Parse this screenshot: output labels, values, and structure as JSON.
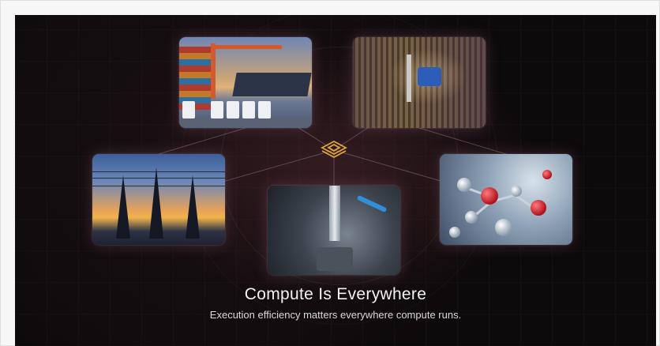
{
  "hero": {
    "title": "Compute Is Everywhere",
    "subtitle": "Execution efficiency matters everywhere compute runs."
  },
  "images": [
    {
      "name": "shipping-port-image"
    },
    {
      "name": "agriculture-drone-image"
    },
    {
      "name": "power-lines-image"
    },
    {
      "name": "cnc-machining-image"
    },
    {
      "name": "molecules-image"
    }
  ],
  "icons": {
    "center": "layered-chip-logo-icon"
  },
  "colors": {
    "background": "#0d0a0b",
    "accent": "#e0a63a",
    "text": "#f2f2f2"
  }
}
